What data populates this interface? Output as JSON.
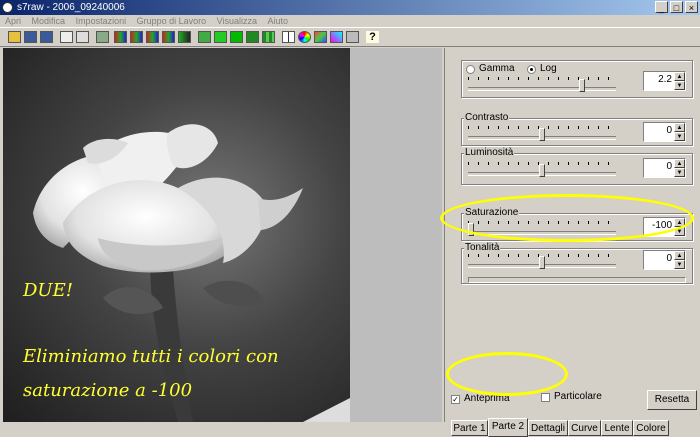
{
  "window": {
    "title": "s7raw - 2006_09240006"
  },
  "menu": [
    "Apri",
    "Modifica",
    "Impostazioni",
    "Gruppo di Lavoro",
    "Visualizza",
    "Aiuto"
  ],
  "toolbar": {
    "icons": [
      "open-icon",
      "save-icon",
      "save-as-icon",
      "copy-icon",
      "paste-icon",
      "settings-icon",
      "rgb-icon",
      "rgb-icon",
      "rgb-icon",
      "rgb-icon",
      "rgb-icon",
      "layers-icon",
      "green-square-icon",
      "green-square-icon",
      "green-square-icon",
      "green-grid-icon",
      "grid-icon",
      "color-wheel-icon",
      "palette-icon",
      "dropper-icon",
      "window-icon",
      "help-icon"
    ]
  },
  "overlay": {
    "line1": "DUE!",
    "line2": "Eliminiamo tutti i colori con",
    "line3": "saturazione a -100"
  },
  "panel": {
    "gamma_label": "Gamma",
    "log_label": "Log",
    "gamma_value": "2.2",
    "gamma_slider": 0.78,
    "contrast_label": "Contrasto",
    "contrast_value": "0",
    "contrast_slider": 0.5,
    "brightness_label": "Luminosità",
    "brightness_value": "0",
    "brightness_slider": 0.5,
    "saturation_label": "Saturazione",
    "saturation_value": "-100",
    "saturation_slider": 0.0,
    "tonality_label": "Tonalità",
    "tonality_value": "0",
    "tonality_slider": 0.5
  },
  "tabs": [
    "Parte 1",
    "Parte 2",
    "Dettagli",
    "Curve",
    "Lente",
    "Colore"
  ],
  "active_tab": "Parte 2",
  "footer": {
    "preview_label": "Anteprima",
    "preview_checked": true,
    "particular_label": "Particolare",
    "particular_checked": false,
    "reset_label": "Resetta"
  },
  "colors": {
    "highlight": "#ffff00",
    "overlay_text": "#ffff33",
    "title_bar": "#0a246a"
  }
}
